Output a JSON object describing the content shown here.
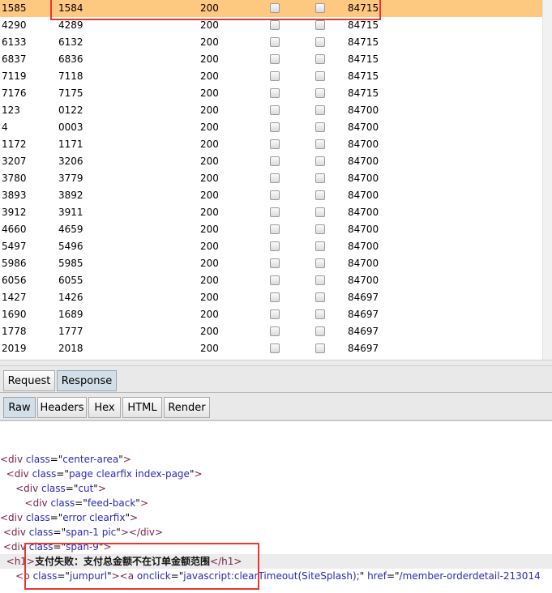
{
  "results": {
    "rows": [
      {
        "id": "1585",
        "payload": "1584",
        "status": "200",
        "length": "84715",
        "selected": true
      },
      {
        "id": "4290",
        "payload": "4289",
        "status": "200",
        "length": "84715"
      },
      {
        "id": "6133",
        "payload": "6132",
        "status": "200",
        "length": "84715"
      },
      {
        "id": "6837",
        "payload": "6836",
        "status": "200",
        "length": "84715"
      },
      {
        "id": "7119",
        "payload": "7118",
        "status": "200",
        "length": "84715"
      },
      {
        "id": "7176",
        "payload": "7175",
        "status": "200",
        "length": "84715"
      },
      {
        "id": "123",
        "payload": "0122",
        "status": "200",
        "length": "84700"
      },
      {
        "id": "4",
        "payload": "0003",
        "status": "200",
        "length": "84700"
      },
      {
        "id": "1172",
        "payload": "1171",
        "status": "200",
        "length": "84700"
      },
      {
        "id": "3207",
        "payload": "3206",
        "status": "200",
        "length": "84700"
      },
      {
        "id": "3780",
        "payload": "3779",
        "status": "200",
        "length": "84700"
      },
      {
        "id": "3893",
        "payload": "3892",
        "status": "200",
        "length": "84700"
      },
      {
        "id": "3912",
        "payload": "3911",
        "status": "200",
        "length": "84700"
      },
      {
        "id": "4660",
        "payload": "4659",
        "status": "200",
        "length": "84700"
      },
      {
        "id": "5497",
        "payload": "5496",
        "status": "200",
        "length": "84700"
      },
      {
        "id": "5986",
        "payload": "5985",
        "status": "200",
        "length": "84700"
      },
      {
        "id": "6056",
        "payload": "6055",
        "status": "200",
        "length": "84700"
      },
      {
        "id": "1427",
        "payload": "1426",
        "status": "200",
        "length": "84697"
      },
      {
        "id": "1690",
        "payload": "1689",
        "status": "200",
        "length": "84697"
      },
      {
        "id": "1778",
        "payload": "1777",
        "status": "200",
        "length": "84697"
      },
      {
        "id": "2019",
        "payload": "2018",
        "status": "200",
        "length": "84697"
      }
    ]
  },
  "tabs": {
    "request": "Request",
    "response": "Response"
  },
  "viewtabs": {
    "raw": "Raw",
    "headers": "Headers",
    "hex": "Hex",
    "html": "HTML",
    "render": "Render"
  },
  "code": {
    "lines": [
      {
        "indent": "",
        "parts": [
          [
            "tg",
            "<div "
          ],
          [
            "an",
            "class"
          ],
          [
            "tx",
            "=\""
          ],
          [
            "av",
            "center-area"
          ],
          [
            "tx",
            "\""
          ],
          [
            "tg",
            ">"
          ]
        ]
      },
      {
        "indent": "  ",
        "parts": [
          [
            "tg",
            "<div "
          ],
          [
            "an",
            "class"
          ],
          [
            "tx",
            "=\""
          ],
          [
            "av",
            "page clearfix index-page"
          ],
          [
            "tx",
            "\""
          ],
          [
            "tg",
            ">"
          ]
        ]
      },
      {
        "indent": "     ",
        "parts": [
          [
            "tg",
            "<div "
          ],
          [
            "an",
            "class"
          ],
          [
            "tx",
            "=\""
          ],
          [
            "av",
            "cut"
          ],
          [
            "tx",
            "\""
          ],
          [
            "tg",
            ">"
          ]
        ]
      },
      {
        "indent": "        ",
        "parts": [
          [
            "tg",
            "<div "
          ],
          [
            "an",
            "class"
          ],
          [
            "tx",
            "=\""
          ],
          [
            "av",
            "feed-back"
          ],
          [
            "tx",
            "\""
          ],
          [
            "tg",
            ">"
          ]
        ]
      },
      {
        "indent": "",
        "parts": [
          [
            "tg",
            "<div "
          ],
          [
            "an",
            "class"
          ],
          [
            "tx",
            "=\""
          ],
          [
            "av",
            "error clearfix"
          ],
          [
            "tx",
            "\""
          ],
          [
            "tg",
            ">"
          ]
        ]
      },
      {
        "indent": " ",
        "parts": [
          [
            "tg",
            "<div "
          ],
          [
            "an",
            "class"
          ],
          [
            "tx",
            "=\""
          ],
          [
            "av",
            "span-1 pic"
          ],
          [
            "tx",
            "\""
          ],
          [
            "tg",
            "></div>"
          ]
        ]
      },
      {
        "indent": " ",
        "parts": [
          [
            "tg",
            "<div "
          ],
          [
            "an",
            "class"
          ],
          [
            "tx",
            "=\""
          ],
          [
            "av",
            "span-9"
          ],
          [
            "tx",
            "\""
          ],
          [
            "tg",
            ">"
          ]
        ]
      },
      {
        "indent": "  ",
        "highlight": true,
        "parts": [
          [
            "tg",
            "<h1>"
          ],
          [
            "bold",
            "支付失败：支付总金额不在订单金额范围"
          ],
          [
            "tg",
            "</h1>"
          ]
        ]
      },
      {
        "indent": "     ",
        "parts": [
          [
            "tg",
            "<p "
          ],
          [
            "an",
            "class"
          ],
          [
            "tx",
            "=\""
          ],
          [
            "av",
            "jumpurl"
          ],
          [
            "tx",
            "\""
          ],
          [
            "tg",
            "><a "
          ],
          [
            "an",
            "onclick"
          ],
          [
            "tx",
            "=\""
          ],
          [
            "av",
            "javascript:clearTimeout(SiteSplash);"
          ],
          [
            "tx",
            "\" "
          ],
          [
            "an",
            "href"
          ],
          [
            "tx",
            "=\""
          ],
          [
            "av",
            "/member-orderdetail-213014"
          ]
        ]
      }
    ]
  }
}
